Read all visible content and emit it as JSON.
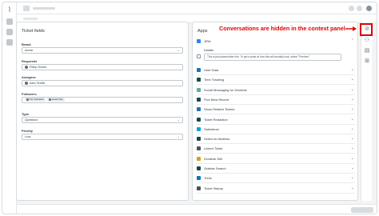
{
  "ticket": {
    "title": "Ticket fields",
    "fields": {
      "brand": {
        "label": "Brand",
        "value": "Acme"
      },
      "requester": {
        "label": "Requester",
        "value": "Riley Green"
      },
      "assignee": {
        "label": "Assignee",
        "value": "Alex Smith"
      },
      "followers": {
        "label": "Followers",
        "values": [
          "Kim Edwards",
          "Jared Tate"
        ]
      },
      "type": {
        "label": "Type",
        "value": "Question"
      },
      "priority": {
        "label": "Priority",
        "value": "Low"
      }
    }
  },
  "apps": {
    "title": "Apps",
    "jira": {
      "name": "JIRA",
      "details_label": "Details",
      "info_text": "This is just placeholder info. To get a peak at how this will actually look, select \"Preview\""
    },
    "items": [
      {
        "name": "User Data",
        "color": "#1f73b7"
      },
      {
        "name": "Time Tracking",
        "color": "#17494d"
      },
      {
        "name": "Social Messaging for Zendesk",
        "color": "#5eae91"
      },
      {
        "name": "Five Most Recent",
        "color": "#17494d"
      },
      {
        "name": "Show Related Tickets",
        "color": "#1f73b7"
      },
      {
        "name": "Ticket Redaction",
        "color": "#17494d"
      },
      {
        "name": "Salesforce",
        "color": "#00a1e0"
      },
      {
        "name": "Select an Address",
        "color": "#17494d"
      },
      {
        "name": "Linked Ticket",
        "color": "#49545c"
      },
      {
        "name": "Zendesk Sell",
        "color": "#d4a017"
      },
      {
        "name": "Sidebar Search",
        "color": "#17494d"
      },
      {
        "name": "Trello",
        "color": "#0079bf"
      },
      {
        "name": "Ticket History",
        "color": "#49545c"
      }
    ]
  },
  "annotation": {
    "text": "Conversations are hidden in the context panel"
  }
}
